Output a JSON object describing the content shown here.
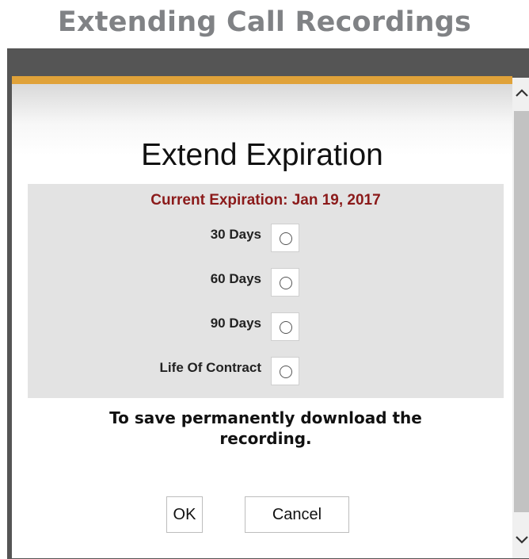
{
  "page": {
    "heading": "Extending Call Recordings"
  },
  "dialog": {
    "title": "Extend Expiration",
    "current_expiration": "Current Expiration: Jan 19, 2017",
    "options": [
      {
        "label": "30 Days",
        "selected": false
      },
      {
        "label": "60 Days",
        "selected": false
      },
      {
        "label": "90 Days",
        "selected": false
      },
      {
        "label": "Life Of Contract",
        "selected": false
      }
    ],
    "save_note_line1": "To save permanently download the",
    "save_note_line2": "recording.",
    "buttons": {
      "ok": "OK",
      "cancel": "Cancel"
    }
  },
  "scrollbar": {
    "up_icon": "^",
    "down_icon": "v"
  },
  "colors": {
    "header_gold": "#e0a239",
    "frame_dark": "#555555",
    "expiration_text": "#8b1a1a",
    "heading_gray": "#808285"
  }
}
